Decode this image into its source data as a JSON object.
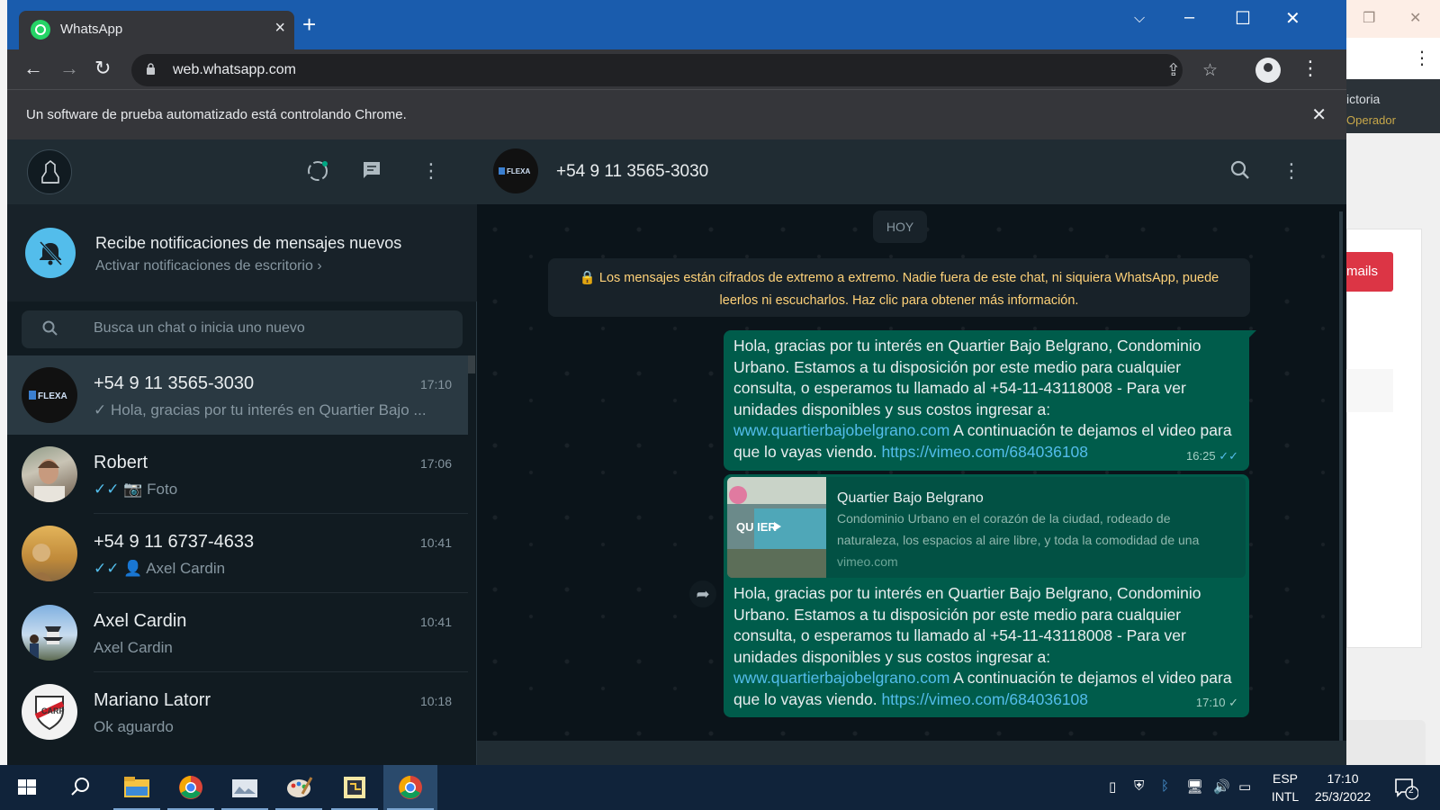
{
  "background_app": {
    "user_partial": "ictoria",
    "role_partial": "Operador",
    "button_partial": "mails"
  },
  "browser": {
    "tab_title": "WhatsApp",
    "new_tab_icon": "plus-icon",
    "url": "web.whatsapp.com",
    "infobar_message": "Un software de prueba automatizado está controlando Chrome.",
    "colors": {
      "tabstrip": "#1a5cad",
      "toolbar": "#35363a"
    }
  },
  "sidebar": {
    "notification_title": "Recibe notificaciones de mensajes nuevos",
    "notification_action": "Activar notificaciones de escritorio ›",
    "search_placeholder": "Busca un chat o inicia uno nuevo",
    "chats": [
      {
        "name": "+54 9 11 3565-3030",
        "time": "17:10",
        "tick": "✓",
        "last": "Hola, gracias por tu interés en Quartier Bajo ..."
      },
      {
        "name": "Robert",
        "time": "17:06",
        "tick": "✓✓",
        "last_icon": "camera-icon",
        "last": "Foto"
      },
      {
        "name": "+54 9 11 6737-4633",
        "time": "10:41",
        "tick": "✓✓",
        "last_icon": "person-icon",
        "last": "Axel Cardin"
      },
      {
        "name": "Axel Cardin",
        "time": "10:41",
        "tick": "",
        "last": "Axel Cardin"
      },
      {
        "name": "Mariano Latorr",
        "time": "10:18",
        "tick": "",
        "last": "Ok aguardo"
      }
    ]
  },
  "conversation": {
    "contact_name": "+54 9 11 3565-3030",
    "avatar_text": "FLEXA",
    "day_chip": "HOY",
    "encryption_notice": "Los mensajes están cifrados de extremo a extremo. Nadie fuera de este chat, ni siquiera WhatsApp, puede leerlos ni escucharlos. Haz clic para obtener más información.",
    "messages": [
      {
        "text_before": "Hola, gracias por tu interés en Quartier Bajo Belgrano, Condominio Urbano. Estamos a tu disposición por este medio para cualquier consulta, o esperamos tu llamado al +54-11-43118008  - Para ver unidades disponibles y sus costos ingresar a:",
        "link1": "www.quartierbajobelgrano.com",
        "text_middle": "A continuación te dejamos el video para que lo vayas viendo.",
        "link2": "https://vimeo.com/684036108",
        "time": "16:25",
        "tick": "✓✓"
      },
      {
        "preview_title": "Quartier Bajo Belgrano",
        "preview_description": "Condominio Urbano en el corazón de la ciudad, rodeado de naturaleza, los espacios al aire libre, y toda la comodidad de una",
        "preview_domain": "vimeo.com",
        "thumb_caption": "QU  IER",
        "text_before": "Hola, gracias por tu interés en Quartier Bajo Belgrano, Condominio Urbano. Estamos a tu disposición por este medio para cualquier consulta, o esperamos tu llamado al +54-11-43118008  - Para ver unidades disponibles y sus costos ingresar a:",
        "link1": "www.quartierbajobelgrano.com",
        "text_middle": "A continuación te dejamos el video para que lo vayas viendo.",
        "link2": "https://vimeo.com/684036108",
        "time": "17:10",
        "tick": "✓"
      }
    ]
  },
  "taskbar": {
    "items": [
      "windows-start-icon",
      "search-icon",
      "file-explorer-icon",
      "chrome-icon",
      "app-icon",
      "paint-icon",
      "python-icon",
      "chrome-active-icon"
    ],
    "lang_line1": "ESP",
    "lang_line2": "INTL",
    "time": "17:10",
    "date": "25/3/2022",
    "notification_count": "2"
  }
}
